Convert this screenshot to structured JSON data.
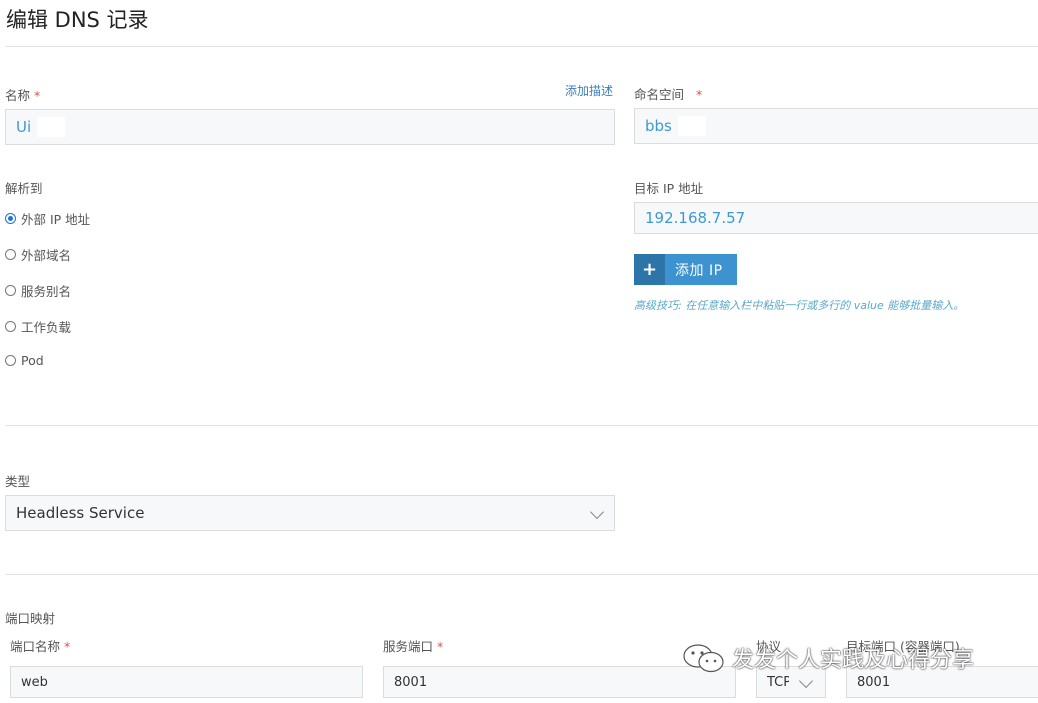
{
  "header": {
    "title": "编辑 DNS 记录"
  },
  "name_field": {
    "label": "名称",
    "required": "*",
    "add_desc": "添加描述",
    "value": "Ui"
  },
  "namespace_field": {
    "label": "命名空间",
    "required": "*",
    "value": "bbs"
  },
  "resolve": {
    "label": "解析到",
    "options": [
      {
        "label": "外部 IP 地址",
        "selected": true
      },
      {
        "label": "外部域名",
        "selected": false
      },
      {
        "label": "服务别名",
        "selected": false
      },
      {
        "label": "工作负载",
        "selected": false
      },
      {
        "label": "Pod",
        "selected": false
      }
    ]
  },
  "target_ip": {
    "label": "目标 IP 地址",
    "value": "192.168.7.57",
    "add_button": "添加 IP",
    "hint": "高级技巧: 在任意输入栏中粘贴一行或多行的 value 能够批量输入。"
  },
  "type_field": {
    "label": "类型",
    "value": "Headless Service"
  },
  "ports": {
    "section_label": "端口映射",
    "port_name_label": "端口名称",
    "service_port_label": "服务端口",
    "protocol_label": "协议",
    "target_port_label": "目标端口 (容器端口)",
    "required": "*",
    "port_name": "web",
    "service_port": "8001",
    "protocol": "TCP",
    "target_port": "8001"
  },
  "watermark": {
    "text": "发发个人实践及心得分享"
  },
  "colors": {
    "accent": "#3c93cf",
    "value_text": "#3d9ad1",
    "required": "#d9534f"
  }
}
